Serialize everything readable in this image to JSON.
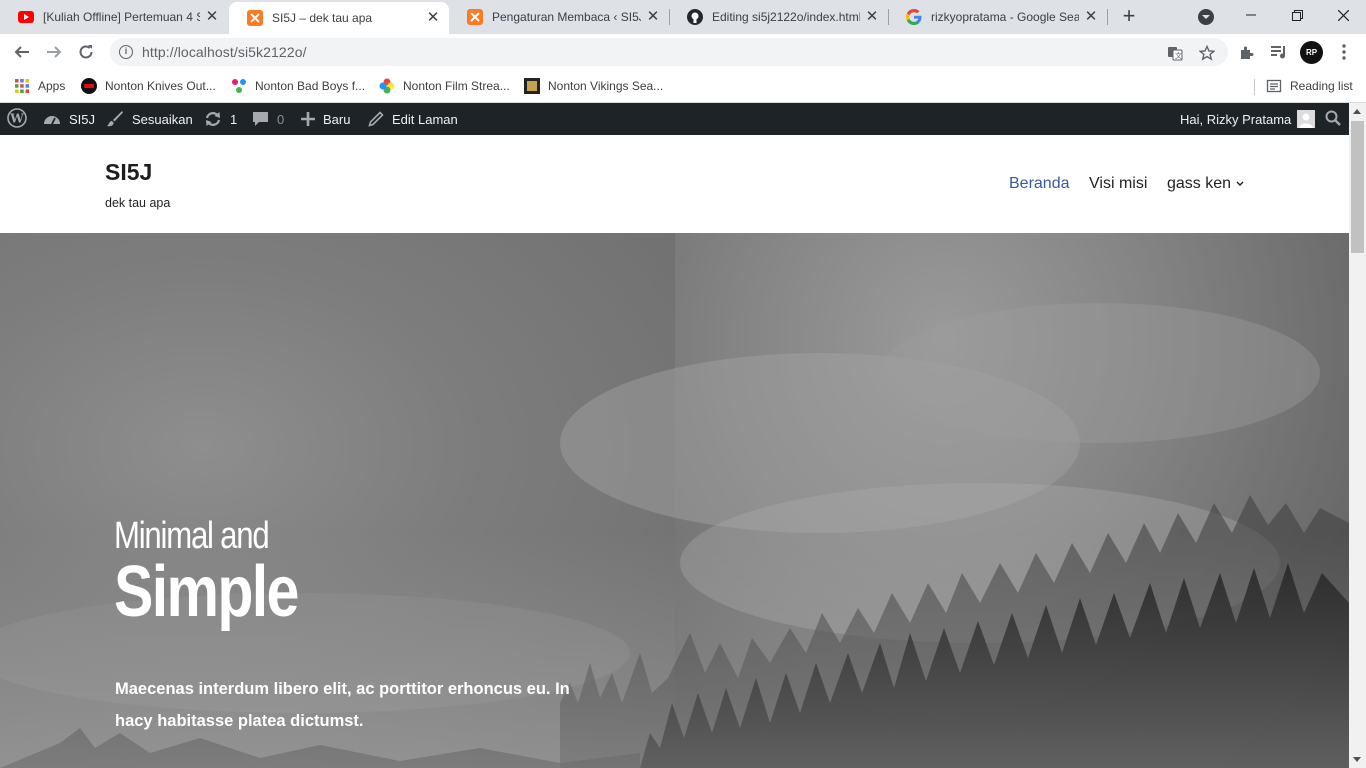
{
  "browser": {
    "tabs": [
      {
        "title": "[Kuliah Offline] Pertemuan 4 S",
        "icon": "youtube-icon"
      },
      {
        "title": "SI5J – dek tau apa",
        "icon": "xampp-icon",
        "active": true
      },
      {
        "title": "Pengaturan Membaca ‹ SI5J –",
        "icon": "xampp-icon"
      },
      {
        "title": "Editing si5j2122o/index.html",
        "icon": "github-icon"
      },
      {
        "title": "rizkyopratama - Google Searc",
        "icon": "google-icon"
      }
    ],
    "url": "http://localhost/si5k2122o/",
    "profile_initials": "RP",
    "bookmarks": [
      {
        "label": "Apps",
        "icon": "apps-grid-icon"
      },
      {
        "label": "Nonton Knives Out...",
        "icon": "bookmark-favicon-red"
      },
      {
        "label": "Nonton Bad Boys f...",
        "icon": "bookmark-favicon-multicolor"
      },
      {
        "label": "Nonton Film Strea...",
        "icon": "bookmark-favicon-petal"
      },
      {
        "label": "Nonton Vikings Sea...",
        "icon": "bookmark-favicon-film"
      }
    ],
    "reading_list": "Reading list"
  },
  "adminbar": {
    "site": "SI5J",
    "customize": "Sesuaikan",
    "updates": "1",
    "comments": "0",
    "new": "Baru",
    "edit": "Edit Laman",
    "greeting": "Hai, Rizky Pratama"
  },
  "site": {
    "title": "SI5J",
    "description": "dek tau apa",
    "menu": [
      {
        "label": "Beranda",
        "current": true
      },
      {
        "label": "Visi misi"
      },
      {
        "label": "gass ken",
        "has_submenu": true
      }
    ]
  },
  "hero": {
    "small": "Minimal and",
    "big": "Simple",
    "text": "Maecenas interdum libero elit, ac porttitor erhoncus eu. In hacy habitasse platea dictumst."
  },
  "colors": {
    "admin_bar_bg": "#1d2327",
    "menu_current": "#3858a8",
    "tab_strip": "#dee1e6"
  }
}
